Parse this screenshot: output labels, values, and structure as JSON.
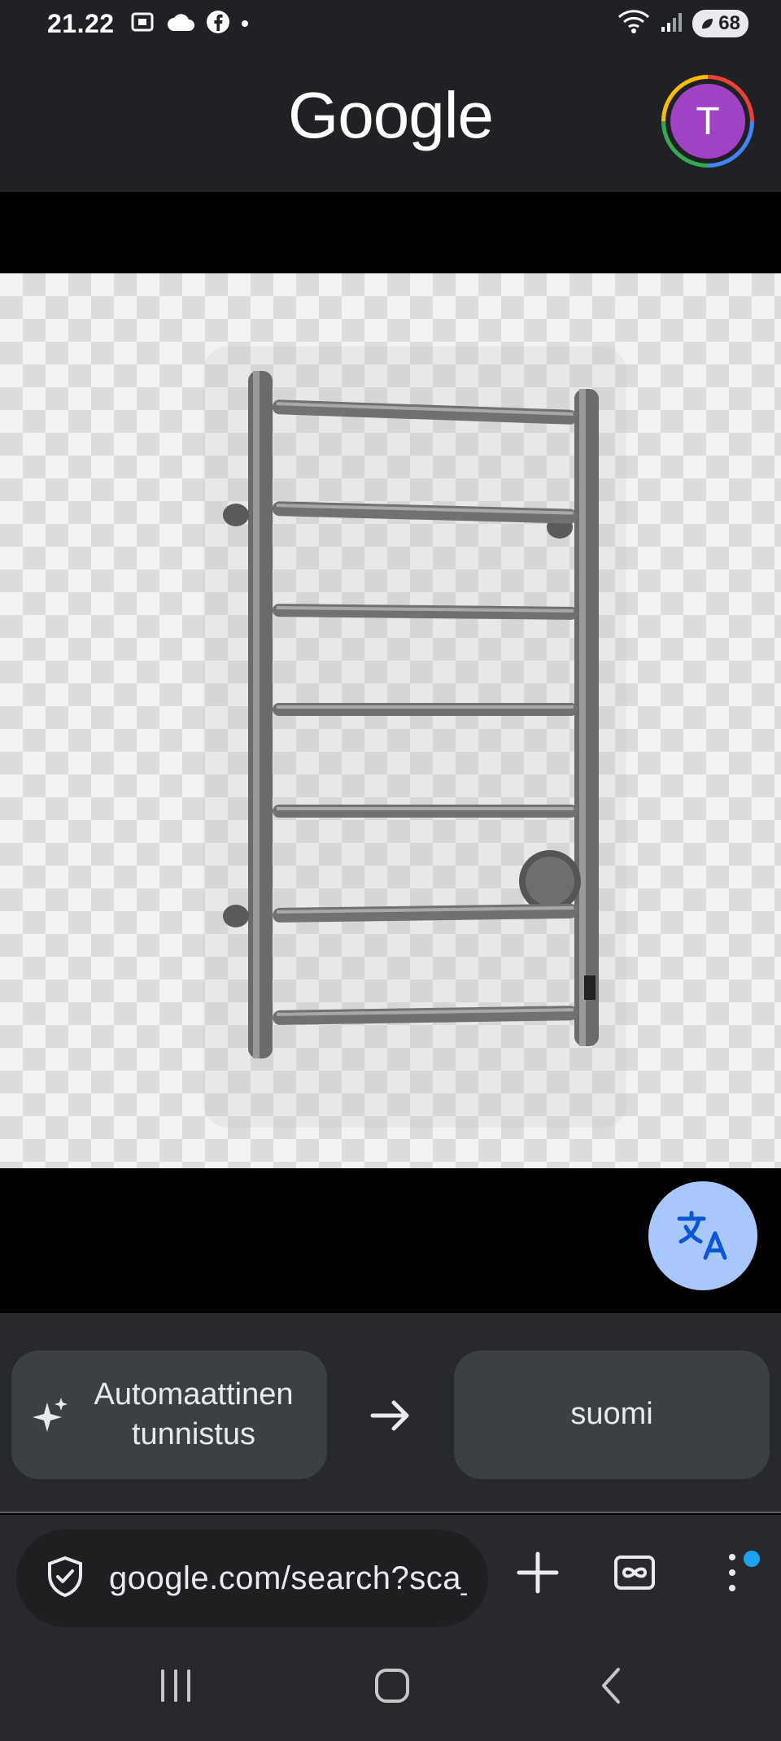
{
  "status_bar": {
    "time": "21.22",
    "battery": "68"
  },
  "header": {
    "logo_text": "Google",
    "avatar_letter": "T"
  },
  "translate": {
    "source_language": "Automaattinen tunnistus",
    "target_language": "suomi"
  },
  "address_bar": {
    "url": "google.com/search?sca_esv"
  },
  "colors": {
    "background": "#202124",
    "avatar": "#a142c4",
    "translate_fab": "#a8c7fa",
    "notification_dot": "#1da1f2"
  },
  "icons": {
    "status_left": [
      "screenshot-icon",
      "cloud-icon",
      "facebook-icon",
      "dot-icon"
    ],
    "status_right": [
      "wifi-icon",
      "signal-icon",
      "battery-icon"
    ],
    "toolbar": [
      "shield-check-icon",
      "new-tab-icon",
      "tab-switcher-icon",
      "more-vert-icon"
    ],
    "nav": [
      "recents-icon",
      "home-icon",
      "back-icon"
    ]
  }
}
